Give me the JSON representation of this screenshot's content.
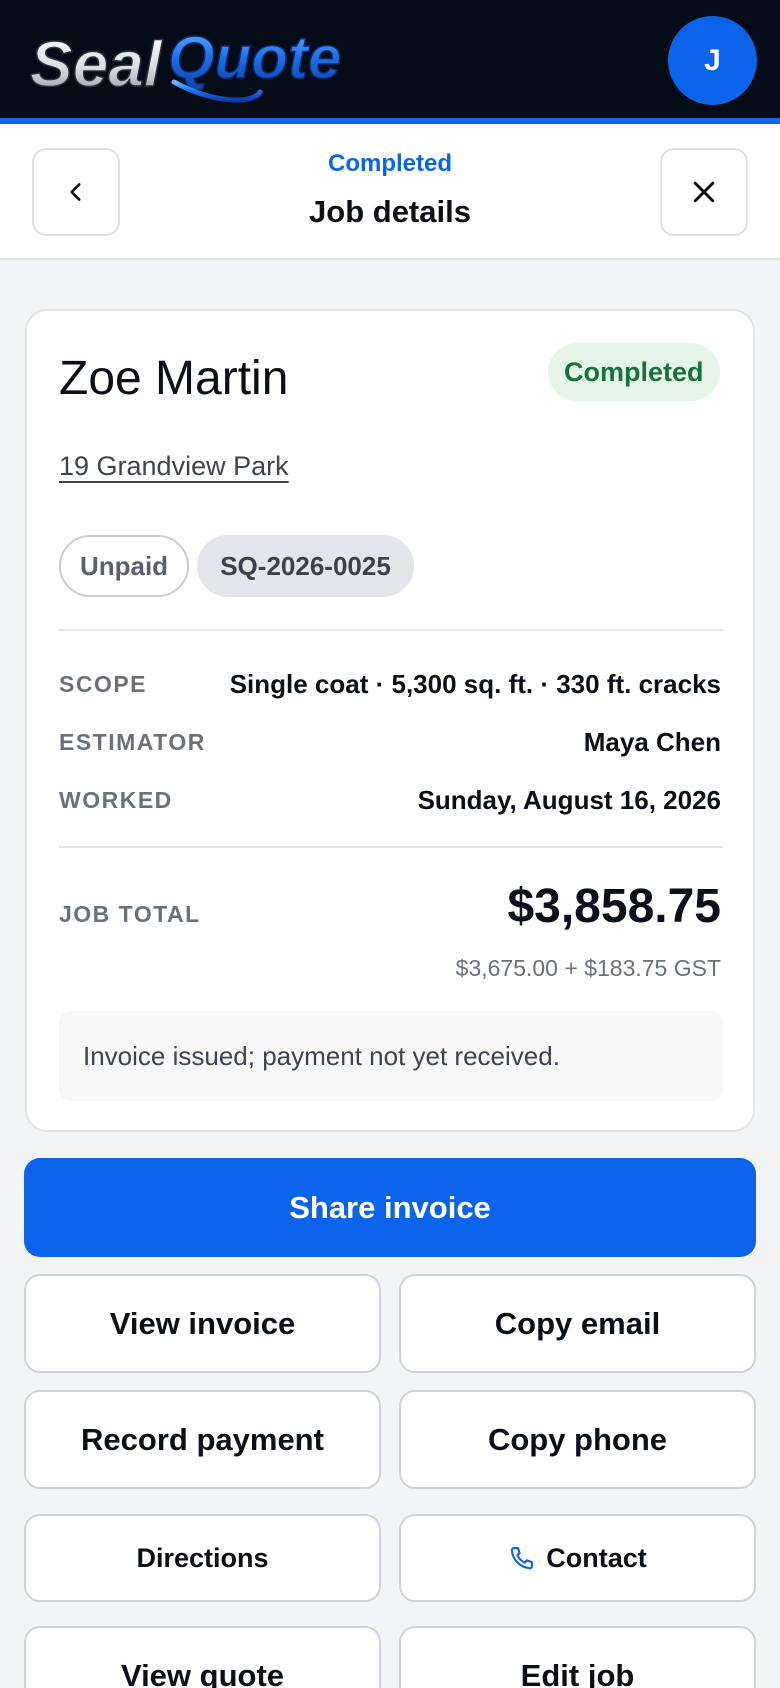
{
  "header": {
    "logo_text_left": "Seal",
    "logo_text_right": "Quote",
    "avatar_initial": "J"
  },
  "subheader": {
    "status": "Completed",
    "title": "Job details"
  },
  "job": {
    "customer_name": "Zoe Martin",
    "status_badge": "Completed",
    "address": "19 Grandview Park",
    "payment_chip": "Unpaid",
    "quote_id": "SQ-2026-0025",
    "details": [
      {
        "label": "SCOPE",
        "value": "Single coat · 5,300 sq. ft. · 330 ft. cracks"
      },
      {
        "label": "ESTIMATOR",
        "value": "Maya Chen"
      },
      {
        "label": "WORKED",
        "value": "Sunday, August 16, 2026"
      }
    ],
    "total_label": "JOB TOTAL",
    "total_value": "$3,858.75",
    "tax_breakdown": "$3,675.00 + $183.75 GST",
    "note": "Invoice issued; payment not yet received."
  },
  "actions": {
    "primary": "Share invoice",
    "view_invoice": "View invoice",
    "copy_email": "Copy email",
    "record_payment": "Record payment",
    "copy_phone": "Copy phone",
    "directions": "Directions",
    "contact": "Contact",
    "view_quote": "View quote",
    "edit_job": "Edit job"
  },
  "colors": {
    "brand_blue": "#0a63e8",
    "header_bg": "#050b17",
    "success_bg": "#e6f5ea",
    "success_text": "#17723a"
  },
  "icons": {
    "back": "chevron-left-icon",
    "close": "close-icon",
    "phone": "phone-icon"
  }
}
